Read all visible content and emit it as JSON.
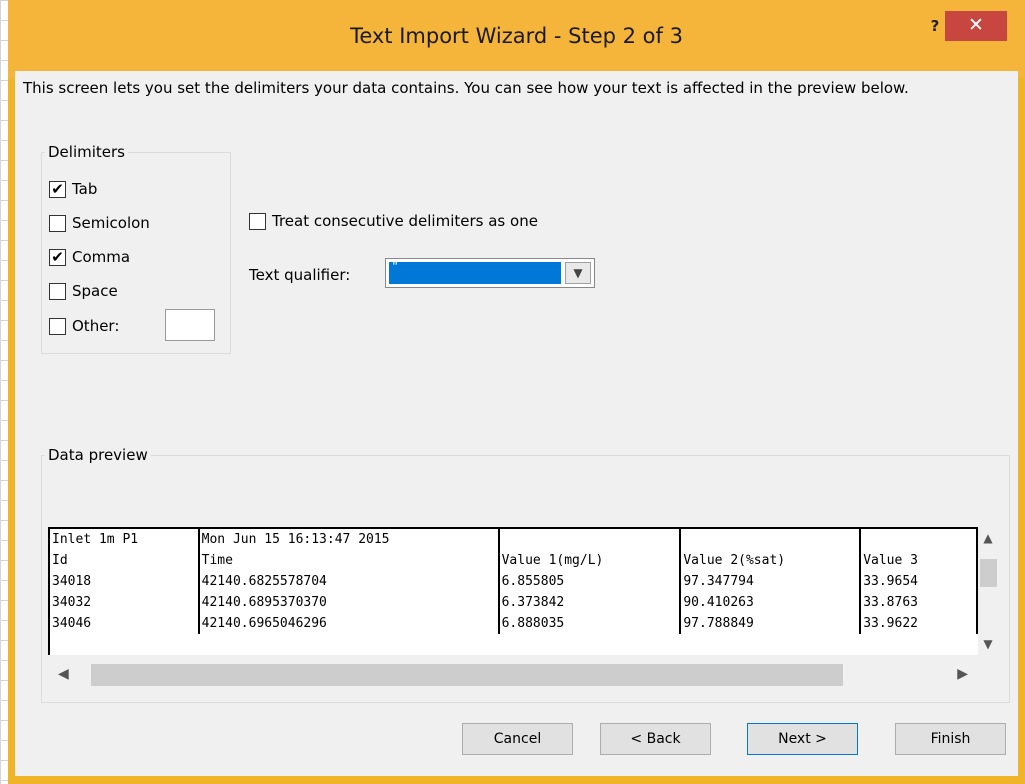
{
  "window": {
    "title": "Text Import Wizard - Step 2 of 3",
    "help_label": "?",
    "close_label": "✕"
  },
  "intro": "This screen lets you set the delimiters your data contains.  You can see how your text is affected in the preview below.",
  "delimiters": {
    "legend": "Delimiters",
    "items": [
      {
        "label": "Tab",
        "checked": true
      },
      {
        "label": "Semicolon",
        "checked": false
      },
      {
        "label": "Comma",
        "checked": true
      },
      {
        "label": "Space",
        "checked": false
      },
      {
        "label": "Other:",
        "checked": false
      }
    ],
    "other_value": ""
  },
  "consecutive": {
    "label": "Treat consecutive delimiters as one",
    "checked": false
  },
  "text_qualifier": {
    "label": "Text qualifier:",
    "value": "\""
  },
  "data_preview": {
    "legend": "Data preview",
    "rows": [
      [
        "Inlet 1m P1",
        "Mon Jun 15 16:13:47 2015",
        "",
        "",
        ""
      ],
      [
        "Id",
        "Time",
        "Value 1(mg/L)",
        "Value 2(%sat)",
        "Value 3"
      ],
      [
        "34018",
        "42140.6825578704",
        "6.855805",
        "97.347794",
        "33.9654"
      ],
      [
        "34032",
        "42140.6895370370",
        "6.373842",
        "90.410263",
        "33.8763"
      ],
      [
        "34046",
        "42140.6965046296",
        "6.888035",
        "97.788849",
        "33.9622"
      ]
    ]
  },
  "buttons": {
    "cancel": "Cancel",
    "back": "< Back",
    "next": "Next >",
    "finish": "Finish"
  }
}
